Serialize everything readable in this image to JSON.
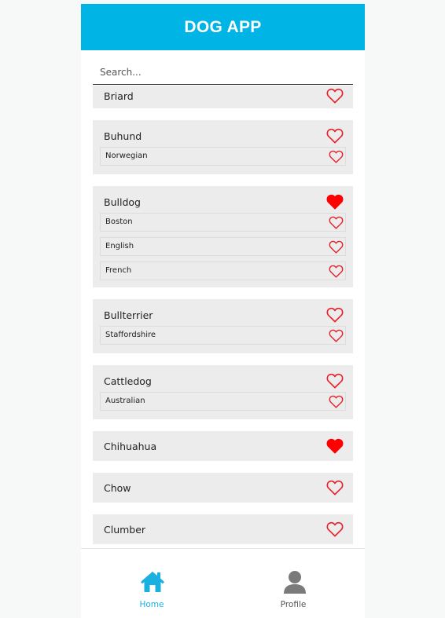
{
  "app": {
    "title": "DOG APP"
  },
  "search": {
    "placeholder": "Search..."
  },
  "colors": {
    "header_bg": "#00b4e6",
    "heart_outline": "#e8202a",
    "heart_filled": "#ff0000",
    "nav_active": "#1ab0e0",
    "nav_inactive": "#7a7a7a",
    "card_bg": "#ececec"
  },
  "breeds": [
    {
      "name": "Briard",
      "favorite": false,
      "subbreeds": []
    },
    {
      "name": "Buhund",
      "favorite": false,
      "subbreeds": [
        {
          "name": "Norwegian",
          "favorite": false
        }
      ]
    },
    {
      "name": "Bulldog",
      "favorite": true,
      "subbreeds": [
        {
          "name": "Boston",
          "favorite": false
        },
        {
          "name": "English",
          "favorite": false
        },
        {
          "name": "French",
          "favorite": false
        }
      ]
    },
    {
      "name": "Bullterrier",
      "favorite": false,
      "subbreeds": [
        {
          "name": "Staffordshire",
          "favorite": false
        }
      ]
    },
    {
      "name": "Cattledog",
      "favorite": false,
      "subbreeds": [
        {
          "name": "Australian",
          "favorite": false
        }
      ]
    },
    {
      "name": "Chihuahua",
      "favorite": true,
      "subbreeds": []
    },
    {
      "name": "Chow",
      "favorite": false,
      "subbreeds": []
    },
    {
      "name": "Clumber",
      "favorite": false,
      "subbreeds": []
    }
  ],
  "nav": {
    "home": {
      "label": "Home",
      "icon": "home-icon",
      "active": true
    },
    "profile": {
      "label": "Profile",
      "icon": "profile-icon",
      "active": false
    }
  }
}
